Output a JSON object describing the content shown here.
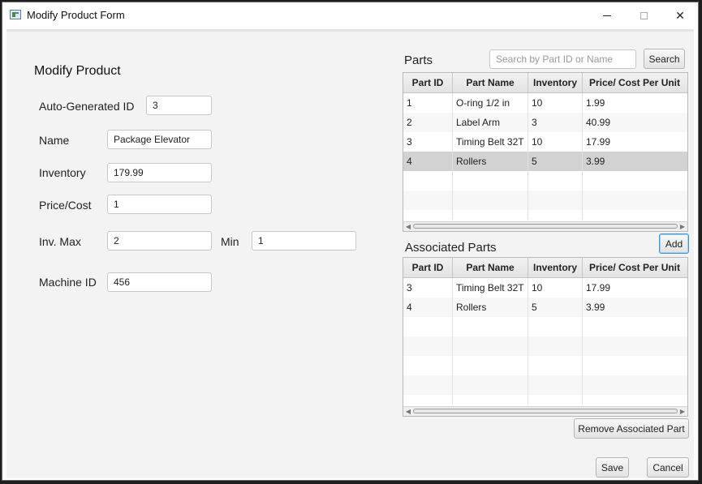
{
  "window": {
    "title": "Modify Product Form"
  },
  "form": {
    "title": "Modify Product",
    "id_label": "Auto-Generated ID",
    "id_value": "3",
    "name_label": "Name",
    "name_value": "Package Elevator",
    "inventory_label": "Inventory",
    "inventory_value": "179.99",
    "price_label": "Price/Cost",
    "price_value": "1",
    "max_label": "Inv. Max",
    "max_value": "2",
    "min_label": "Min",
    "min_value": "1",
    "machine_label": "Machine ID",
    "machine_value": "456"
  },
  "parts": {
    "label": "Parts",
    "search_placeholder": "Search by Part ID or Name",
    "search_button": "Search",
    "add_button": "Add",
    "columns": [
      "Part ID",
      "Part Name",
      "Inventory",
      "Price/ Cost Per Unit"
    ],
    "rows": [
      [
        "1",
        "O-ring 1/2 in",
        "10",
        "1.99"
      ],
      [
        "2",
        "Label Arm",
        "3",
        "40.99"
      ],
      [
        "3",
        "Timing Belt 32T",
        "10",
        "17.99"
      ],
      [
        "4",
        "Rollers",
        "5",
        "3.99"
      ]
    ]
  },
  "associated": {
    "label": "Associated Parts",
    "remove_button": "Remove Associated Part",
    "columns": [
      "Part ID",
      "Part Name",
      "Inventory",
      "Price/ Cost Per Unit"
    ],
    "rows": [
      [
        "3",
        "Timing Belt 32T",
        "10",
        "17.99"
      ],
      [
        "4",
        "Rollers",
        "5",
        "3.99"
      ]
    ]
  },
  "footer": {
    "save_button": "Save",
    "cancel_button": "Cancel"
  },
  "colors": {
    "selected_row": "#d2d2d2",
    "focus_border": "#3c95d6",
    "panel_bg": "#f3f3f4"
  }
}
